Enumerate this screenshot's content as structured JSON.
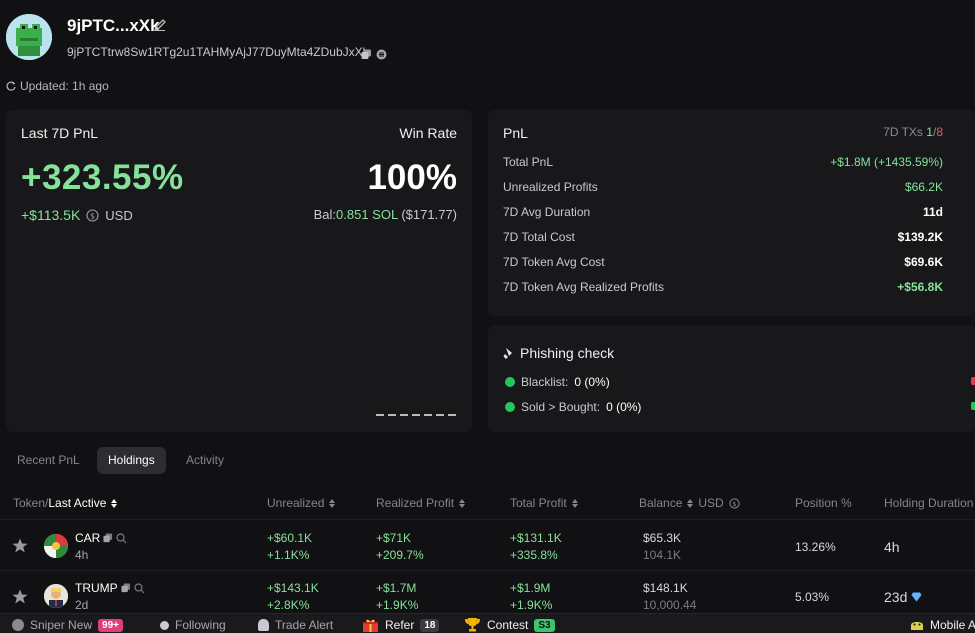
{
  "header": {
    "wallet_name": "9jPTC...xXk",
    "address": "9jPTCTtrw8Sw1RTg2u1TAHMyAjJ77DuyMta4ZDubJxXk",
    "updated": "Updated: 1h ago"
  },
  "summary": {
    "label": "Last 7D PnL",
    "pnl_pct": "+323.55%",
    "pnl_usd": "+$113.5K",
    "currency": "USD",
    "win_rate_label": "Win Rate",
    "win_rate": "100%",
    "bal_label": "Bal:",
    "bal_sol": "0.851 SOL",
    "bal_usd": "($171.77)"
  },
  "pnl": {
    "title": "PnL",
    "tx_label": "7D TXs",
    "tx_wins": "1",
    "tx_sep": "/",
    "tx_total": "8",
    "rows": [
      {
        "label": "Total PnL",
        "value": "+$1.8M (+1435.59%)"
      },
      {
        "label": "Unrealized Profits",
        "value": "$66.2K"
      },
      {
        "label": "7D Avg Duration",
        "value": "11d"
      },
      {
        "label": "7D Total Cost",
        "value": "$139.2K"
      },
      {
        "label": "7D Token Avg Cost",
        "value": "$69.6K"
      },
      {
        "label": "7D Token Avg Realized Profits",
        "value": "+$56.8K"
      }
    ]
  },
  "phishing": {
    "title": "Phishing check",
    "blacklist_label": "Blacklist:",
    "blacklist_value": "0 (0%)",
    "sold_label": "Sold > Bought:",
    "sold_value": "0 (0%)"
  },
  "tabs": [
    "Recent PnL",
    "Holdings",
    "Activity"
  ],
  "table": {
    "headers": {
      "token": "Token/",
      "last_active": "Last Active",
      "unrealized": "Unrealized",
      "realized": "Realized Profit",
      "total": "Total Profit",
      "balance": "Balance",
      "usd": "USD",
      "position": "Position %",
      "duration": "Holding Duration"
    },
    "rows": [
      {
        "symbol": "CAR",
        "age": "4h",
        "unrealized": "+$60.1K",
        "unrealized_pct": "+1.1K%",
        "realized": "+$71K",
        "realized_pct": "+209.7%",
        "total": "+$131.1K",
        "total_pct": "+335.8%",
        "balance_usd": "$65.3K",
        "balance_amt": "104.1K",
        "position": "13.26%",
        "duration": "4h"
      },
      {
        "symbol": "TRUMP",
        "age": "2d",
        "unrealized": "+$143.1K",
        "unrealized_pct": "+2.8K%",
        "realized": "+$1.7M",
        "realized_pct": "+1.9K%",
        "total": "+$1.9M",
        "total_pct": "+1.9K%",
        "balance_usd": "$148.1K",
        "balance_amt": "10,000.44",
        "position": "5.03%",
        "duration": "23d"
      }
    ]
  },
  "bottom_bar": {
    "sniper": "Sniper New",
    "sniper_badge": "99+",
    "following": "Following",
    "trade_alert": "Trade Alert",
    "refer": "Refer",
    "refer_badge": "18",
    "contest": "Contest",
    "contest_badge": "S3",
    "mobile": "Mobile A"
  }
}
